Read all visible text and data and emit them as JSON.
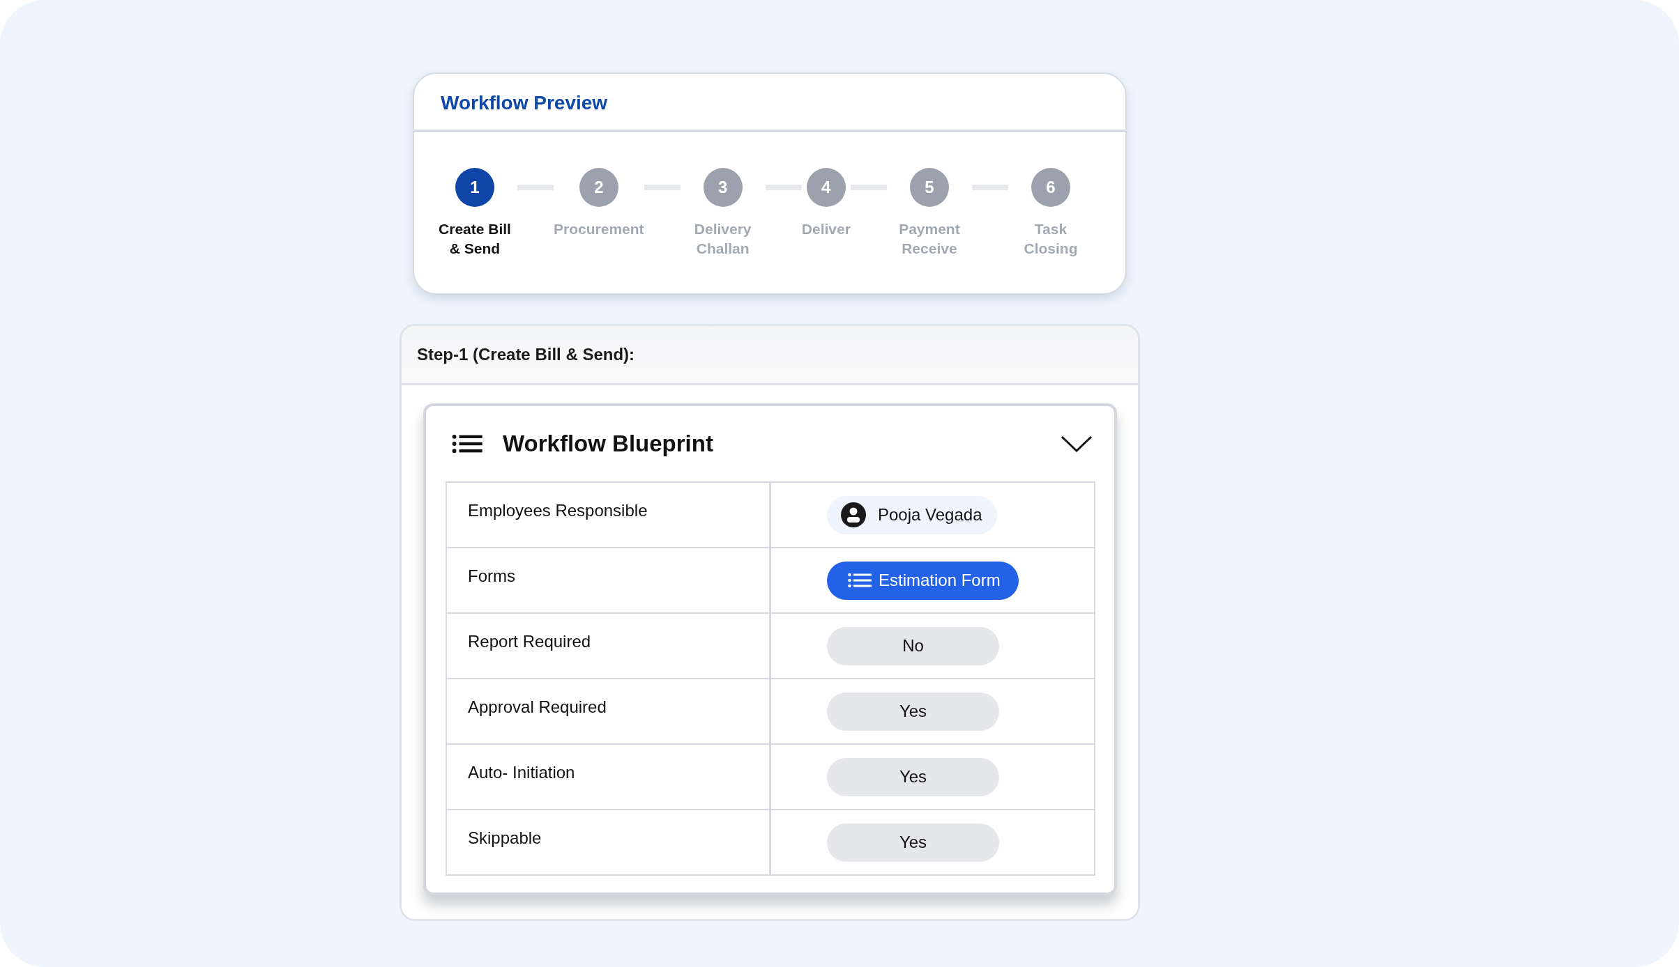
{
  "preview": {
    "title": "Workflow Preview",
    "steps": [
      {
        "number": "1",
        "label": "Create Bill & Send",
        "selected": true
      },
      {
        "number": "2",
        "label": "Procurement",
        "selected": false
      },
      {
        "number": "3",
        "label": "Delivery Challan",
        "selected": false
      },
      {
        "number": "4",
        "label": "Deliver",
        "selected": false
      },
      {
        "number": "5",
        "label": "Payment Receive",
        "selected": false
      },
      {
        "number": "6",
        "label": "Task Closing",
        "selected": false
      }
    ]
  },
  "step_panel": {
    "title": "Step-1 (Create Bill & Send):",
    "blueprint": {
      "title": "Workflow Blueprint",
      "expanded": true,
      "rows": [
        {
          "label": "Employees Responsible",
          "value": "Pooja Vegada",
          "kind": "person"
        },
        {
          "label": "Forms",
          "value": "Estimation Form",
          "kind": "form"
        },
        {
          "label": "Report Required",
          "value": "No",
          "kind": "plain"
        },
        {
          "label": "Approval Required",
          "value": "Yes",
          "kind": "plain"
        },
        {
          "label": "Auto- Initiation",
          "value": "Yes",
          "kind": "plain"
        },
        {
          "label": "Skippable",
          "value": "Yes",
          "kind": "plain"
        }
      ]
    }
  }
}
